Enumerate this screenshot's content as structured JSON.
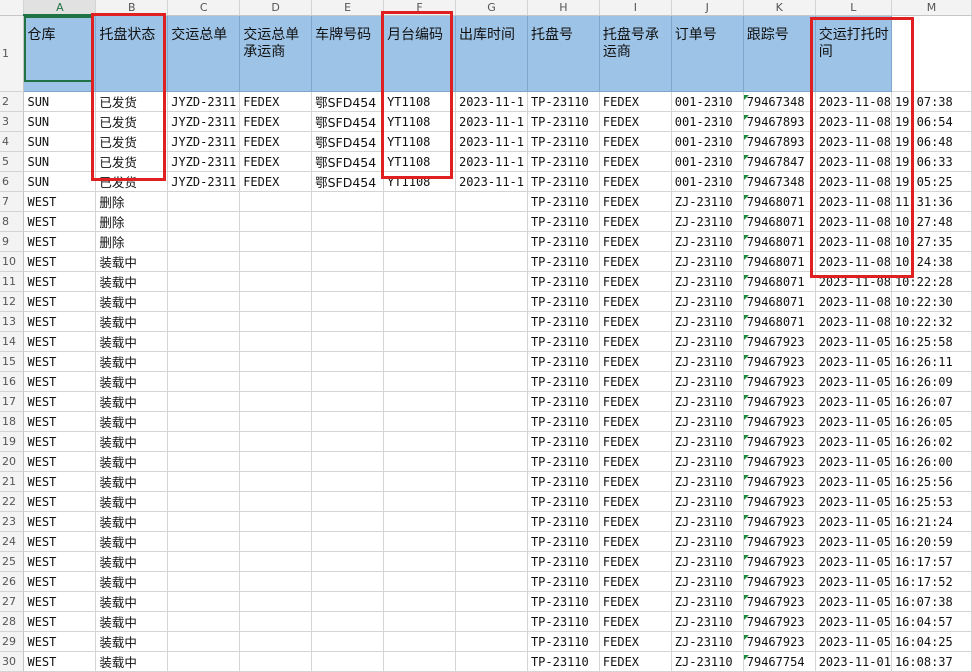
{
  "columns": [
    "A",
    "B",
    "C",
    "D",
    "E",
    "F",
    "G",
    "H",
    "I",
    "J",
    "K",
    "L",
    "M"
  ],
  "header_row_number": "1",
  "headers": [
    "仓库",
    "托盘状态",
    "交运总单",
    "交运总单承运商",
    "车牌号码",
    "月台编码",
    "出库时间",
    "托盘号",
    "托盘号承运商",
    "订单号",
    "跟踪号",
    "交运打托时间",
    ""
  ],
  "rows": [
    {
      "n": "2",
      "cells": [
        "SUN",
        "已发货",
        "JYZD-2311",
        "FEDEX",
        "鄂SFD454",
        "YT1108",
        "2023-11-1",
        "TP-23110",
        "FEDEX",
        "001-2310",
        "79467348",
        "2023-11-08",
        "19:07:38"
      ]
    },
    {
      "n": "3",
      "cells": [
        "SUN",
        "已发货",
        "JYZD-2311",
        "FEDEX",
        "鄂SFD454",
        "YT1108",
        "2023-11-1",
        "TP-23110",
        "FEDEX",
        "001-2310",
        "79467893",
        "2023-11-08",
        "19:06:54"
      ]
    },
    {
      "n": "4",
      "cells": [
        "SUN",
        "已发货",
        "JYZD-2311",
        "FEDEX",
        "鄂SFD454",
        "YT1108",
        "2023-11-1",
        "TP-23110",
        "FEDEX",
        "001-2310",
        "79467893",
        "2023-11-08",
        "19:06:48"
      ]
    },
    {
      "n": "5",
      "cells": [
        "SUN",
        "已发货",
        "JYZD-2311",
        "FEDEX",
        "鄂SFD454",
        "YT1108",
        "2023-11-1",
        "TP-23110",
        "FEDEX",
        "001-2310",
        "79467847",
        "2023-11-08",
        "19:06:33"
      ]
    },
    {
      "n": "6",
      "cells": [
        "SUN",
        "已发货",
        "JYZD-2311",
        "FEDEX",
        "鄂SFD454",
        "YT1108",
        "2023-11-1",
        "TP-23110",
        "FEDEX",
        "001-2310",
        "79467348",
        "2023-11-08",
        "19:05:25"
      ]
    },
    {
      "n": "7",
      "cells": [
        "WEST",
        "删除",
        "",
        "",
        "",
        "",
        "",
        "TP-23110",
        "FEDEX",
        "ZJ-23110",
        "79468071",
        "2023-11-08",
        "11:31:36"
      ]
    },
    {
      "n": "8",
      "cells": [
        "WEST",
        "删除",
        "",
        "",
        "",
        "",
        "",
        "TP-23110",
        "FEDEX",
        "ZJ-23110",
        "79468071",
        "2023-11-08",
        "10:27:48"
      ]
    },
    {
      "n": "9",
      "cells": [
        "WEST",
        "删除",
        "",
        "",
        "",
        "",
        "",
        "TP-23110",
        "FEDEX",
        "ZJ-23110",
        "79468071",
        "2023-11-08",
        "10:27:35"
      ]
    },
    {
      "n": "10",
      "cells": [
        "WEST",
        "装载中",
        "",
        "",
        "",
        "",
        "",
        "TP-23110",
        "FEDEX",
        "ZJ-23110",
        "79468071",
        "2023-11-08",
        "10:24:38"
      ]
    },
    {
      "n": "11",
      "cells": [
        "WEST",
        "装载中",
        "",
        "",
        "",
        "",
        "",
        "TP-23110",
        "FEDEX",
        "ZJ-23110",
        "79468071",
        "2023-11-08",
        "10:22:28"
      ]
    },
    {
      "n": "12",
      "cells": [
        "WEST",
        "装载中",
        "",
        "",
        "",
        "",
        "",
        "TP-23110",
        "FEDEX",
        "ZJ-23110",
        "79468071",
        "2023-11-08",
        "10:22:30"
      ]
    },
    {
      "n": "13",
      "cells": [
        "WEST",
        "装载中",
        "",
        "",
        "",
        "",
        "",
        "TP-23110",
        "FEDEX",
        "ZJ-23110",
        "79468071",
        "2023-11-08",
        "10:22:32"
      ]
    },
    {
      "n": "14",
      "cells": [
        "WEST",
        "装载中",
        "",
        "",
        "",
        "",
        "",
        "TP-23110",
        "FEDEX",
        "ZJ-23110",
        "79467923",
        "2023-11-05",
        "16:25:58"
      ]
    },
    {
      "n": "15",
      "cells": [
        "WEST",
        "装载中",
        "",
        "",
        "",
        "",
        "",
        "TP-23110",
        "FEDEX",
        "ZJ-23110",
        "79467923",
        "2023-11-05",
        "16:26:11"
      ]
    },
    {
      "n": "16",
      "cells": [
        "WEST",
        "装载中",
        "",
        "",
        "",
        "",
        "",
        "TP-23110",
        "FEDEX",
        "ZJ-23110",
        "79467923",
        "2023-11-05",
        "16:26:09"
      ]
    },
    {
      "n": "17",
      "cells": [
        "WEST",
        "装载中",
        "",
        "",
        "",
        "",
        "",
        "TP-23110",
        "FEDEX",
        "ZJ-23110",
        "79467923",
        "2023-11-05",
        "16:26:07"
      ]
    },
    {
      "n": "18",
      "cells": [
        "WEST",
        "装载中",
        "",
        "",
        "",
        "",
        "",
        "TP-23110",
        "FEDEX",
        "ZJ-23110",
        "79467923",
        "2023-11-05",
        "16:26:05"
      ]
    },
    {
      "n": "19",
      "cells": [
        "WEST",
        "装载中",
        "",
        "",
        "",
        "",
        "",
        "TP-23110",
        "FEDEX",
        "ZJ-23110",
        "79467923",
        "2023-11-05",
        "16:26:02"
      ]
    },
    {
      "n": "20",
      "cells": [
        "WEST",
        "装载中",
        "",
        "",
        "",
        "",
        "",
        "TP-23110",
        "FEDEX",
        "ZJ-23110",
        "79467923",
        "2023-11-05",
        "16:26:00"
      ]
    },
    {
      "n": "21",
      "cells": [
        "WEST",
        "装载中",
        "",
        "",
        "",
        "",
        "",
        "TP-23110",
        "FEDEX",
        "ZJ-23110",
        "79467923",
        "2023-11-05",
        "16:25:56"
      ]
    },
    {
      "n": "22",
      "cells": [
        "WEST",
        "装载中",
        "",
        "",
        "",
        "",
        "",
        "TP-23110",
        "FEDEX",
        "ZJ-23110",
        "79467923",
        "2023-11-05",
        "16:25:53"
      ]
    },
    {
      "n": "23",
      "cells": [
        "WEST",
        "装载中",
        "",
        "",
        "",
        "",
        "",
        "TP-23110",
        "FEDEX",
        "ZJ-23110",
        "79467923",
        "2023-11-05",
        "16:21:24"
      ]
    },
    {
      "n": "24",
      "cells": [
        "WEST",
        "装载中",
        "",
        "",
        "",
        "",
        "",
        "TP-23110",
        "FEDEX",
        "ZJ-23110",
        "79467923",
        "2023-11-05",
        "16:20:59"
      ]
    },
    {
      "n": "25",
      "cells": [
        "WEST",
        "装载中",
        "",
        "",
        "",
        "",
        "",
        "TP-23110",
        "FEDEX",
        "ZJ-23110",
        "79467923",
        "2023-11-05",
        "16:17:57"
      ]
    },
    {
      "n": "26",
      "cells": [
        "WEST",
        "装载中",
        "",
        "",
        "",
        "",
        "",
        "TP-23110",
        "FEDEX",
        "ZJ-23110",
        "79467923",
        "2023-11-05",
        "16:17:52"
      ]
    },
    {
      "n": "27",
      "cells": [
        "WEST",
        "装载中",
        "",
        "",
        "",
        "",
        "",
        "TP-23110",
        "FEDEX",
        "ZJ-23110",
        "79467923",
        "2023-11-05",
        "16:07:38"
      ]
    },
    {
      "n": "28",
      "cells": [
        "WEST",
        "装载中",
        "",
        "",
        "",
        "",
        "",
        "TP-23110",
        "FEDEX",
        "ZJ-23110",
        "79467923",
        "2023-11-05",
        "16:04:57"
      ]
    },
    {
      "n": "29",
      "cells": [
        "WEST",
        "装载中",
        "",
        "",
        "",
        "",
        "",
        "TP-23110",
        "FEDEX",
        "ZJ-23110",
        "79467923",
        "2023-11-05",
        "16:04:25"
      ]
    },
    {
      "n": "30",
      "cells": [
        "WEST",
        "装载中",
        "",
        "",
        "",
        "",
        "",
        "TP-23110",
        "FEDEX",
        "ZJ-23110",
        "79467754",
        "2023-11-01",
        "16:08:37"
      ]
    }
  ],
  "highlight_color": "#e02020",
  "header_fill_color": "#9dc3e6",
  "active_cell": "A1"
}
